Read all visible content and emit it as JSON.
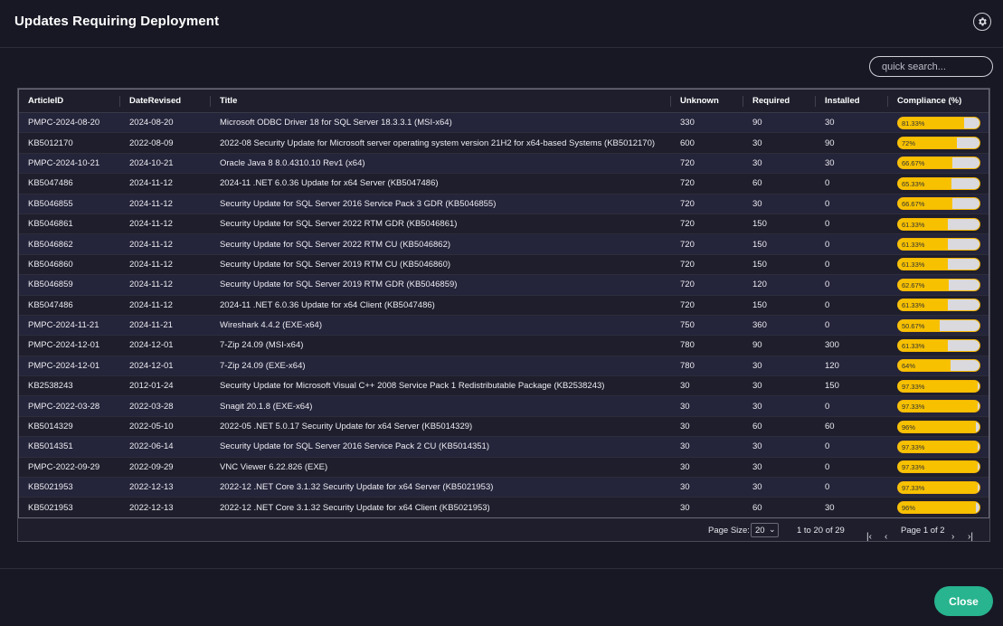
{
  "header": {
    "title": "Updates Requiring Deployment",
    "settings_icon": "gear-icon"
  },
  "search": {
    "placeholder": "quick search..."
  },
  "table": {
    "columns": [
      "ArticleID",
      "DateRevised",
      "Title",
      "Unknown",
      "Required",
      "Installed",
      "Compliance (%)"
    ],
    "rows": [
      [
        "PMPC-2024-08-20",
        "2024-08-20",
        "Microsoft ODBC Driver 18 for SQL Server 18.3.3.1 (MSI-x64)",
        "330",
        "90",
        "30",
        "81.33%"
      ],
      [
        "KB5012170",
        "2022-08-09",
        "2022-08 Security Update for Microsoft server operating system version 21H2 for x64-based Systems (KB5012170)",
        "600",
        "30",
        "90",
        "72%"
      ],
      [
        "PMPC-2024-10-21",
        "2024-10-21",
        "Oracle Java 8 8.0.4310.10 Rev1 (x64)",
        "720",
        "30",
        "30",
        "66.67%"
      ],
      [
        "KB5047486",
        "2024-11-12",
        "2024-11 .NET 6.0.36 Update for x64 Server (KB5047486)",
        "720",
        "60",
        "0",
        "65.33%"
      ],
      [
        "KB5046855",
        "2024-11-12",
        "Security Update for SQL Server 2016 Service Pack 3 GDR (KB5046855)",
        "720",
        "30",
        "0",
        "66.67%"
      ],
      [
        "KB5046861",
        "2024-11-12",
        "Security Update for SQL Server 2022 RTM GDR (KB5046861)",
        "720",
        "150",
        "0",
        "61.33%"
      ],
      [
        "KB5046862",
        "2024-11-12",
        "Security Update for SQL Server 2022 RTM CU (KB5046862)",
        "720",
        "150",
        "0",
        "61.33%"
      ],
      [
        "KB5046860",
        "2024-11-12",
        "Security Update for SQL Server 2019 RTM CU (KB5046860)",
        "720",
        "150",
        "0",
        "61.33%"
      ],
      [
        "KB5046859",
        "2024-11-12",
        "Security Update for SQL Server 2019 RTM GDR (KB5046859)",
        "720",
        "120",
        "0",
        "62.67%"
      ],
      [
        "KB5047486",
        "2024-11-12",
        "2024-11 .NET 6.0.36 Update for x64 Client (KB5047486)",
        "720",
        "150",
        "0",
        "61.33%"
      ],
      [
        "PMPC-2024-11-21",
        "2024-11-21",
        "Wireshark 4.4.2 (EXE-x64)",
        "750",
        "360",
        "0",
        "50.67%"
      ],
      [
        "PMPC-2024-12-01",
        "2024-12-01",
        "7-Zip 24.09 (MSI-x64)",
        "780",
        "90",
        "300",
        "61.33%"
      ],
      [
        "PMPC-2024-12-01",
        "2024-12-01",
        "7-Zip 24.09 (EXE-x64)",
        "780",
        "30",
        "120",
        "64%"
      ],
      [
        "KB2538243",
        "2012-01-24",
        "Security Update for Microsoft Visual C++ 2008 Service Pack 1 Redistributable Package (KB2538243)",
        "30",
        "30",
        "150",
        "97.33%"
      ],
      [
        "PMPC-2022-03-28",
        "2022-03-28",
        "Snagit 20.1.8 (EXE-x64)",
        "30",
        "30",
        "0",
        "97.33%"
      ],
      [
        "KB5014329",
        "2022-05-10",
        "2022-05 .NET 5.0.17 Security Update for x64 Server (KB5014329)",
        "30",
        "60",
        "60",
        "96%"
      ],
      [
        "KB5014351",
        "2022-06-14",
        "Security Update for SQL Server 2016 Service Pack 2 CU (KB5014351)",
        "30",
        "30",
        "0",
        "97.33%"
      ],
      [
        "PMPC-2022-09-29",
        "2022-09-29",
        "VNC Viewer 6.22.826 (EXE)",
        "30",
        "30",
        "0",
        "97.33%"
      ],
      [
        "KB5021953",
        "2022-12-13",
        "2022-12 .NET Core 3.1.32 Security Update for x64 Server (KB5021953)",
        "30",
        "30",
        "0",
        "97.33%"
      ],
      [
        "KB5021953",
        "2022-12-13",
        "2022-12 .NET Core 3.1.32 Security Update for x64 Client (KB5021953)",
        "30",
        "60",
        "30",
        "96%"
      ]
    ],
    "compliance_values": [
      81.33,
      72,
      66.67,
      65.33,
      66.67,
      61.33,
      61.33,
      61.33,
      62.67,
      61.33,
      50.67,
      61.33,
      64,
      97.33,
      97.33,
      96,
      97.33,
      97.33,
      97.33,
      96
    ]
  },
  "pager": {
    "page_size_label": "Page Size:",
    "page_size_value": "20",
    "range_text": "1 to 20 of 29",
    "page_text": "Page 1 of 2"
  },
  "footer": {
    "close_label": "Close"
  },
  "colors": {
    "accent": "#27b48e",
    "bar_fill": "#f7c100",
    "bar_track": "#d9d9de"
  }
}
